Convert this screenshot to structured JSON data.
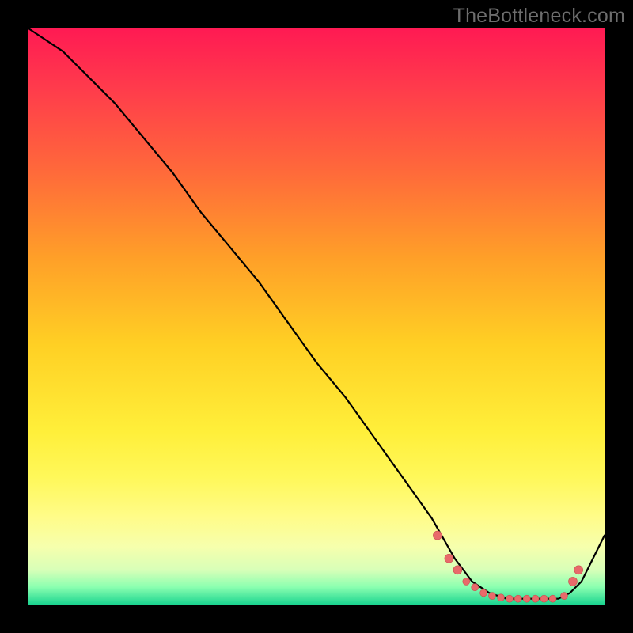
{
  "watermark": "TheBottleneck.com",
  "colors": {
    "gradient_top": "#ff1a53",
    "gradient_mid": "#ffd024",
    "gradient_bottom": "#1bd490",
    "line": "#000000",
    "dot_fill": "#e86a6a",
    "dot_stroke": "#c94f4f"
  },
  "chart_data": {
    "type": "line",
    "title": "",
    "xlabel": "",
    "ylabel": "",
    "xlim": [
      0,
      100
    ],
    "ylim": [
      0,
      100
    ],
    "x": [
      0,
      6,
      10,
      15,
      20,
      25,
      30,
      35,
      40,
      45,
      50,
      55,
      60,
      65,
      70,
      74,
      77,
      80,
      83,
      86,
      89,
      92,
      94,
      96,
      100
    ],
    "values": [
      100,
      96,
      92,
      87,
      81,
      75,
      68,
      62,
      56,
      49,
      42,
      36,
      29,
      22,
      15,
      8,
      4,
      2,
      1,
      1,
      1,
      1,
      2,
      4,
      12
    ],
    "markers": {
      "x": [
        71,
        73,
        74.5,
        76,
        77.5,
        79,
        80.5,
        82,
        83.5,
        85,
        86.5,
        88,
        89.5,
        91,
        93,
        94.5,
        95.5
      ],
      "values": [
        12,
        8,
        6,
        4,
        3,
        2,
        1.5,
        1.2,
        1.0,
        1.0,
        1.0,
        1.0,
        1.0,
        1.0,
        1.5,
        4,
        6
      ]
    }
  }
}
